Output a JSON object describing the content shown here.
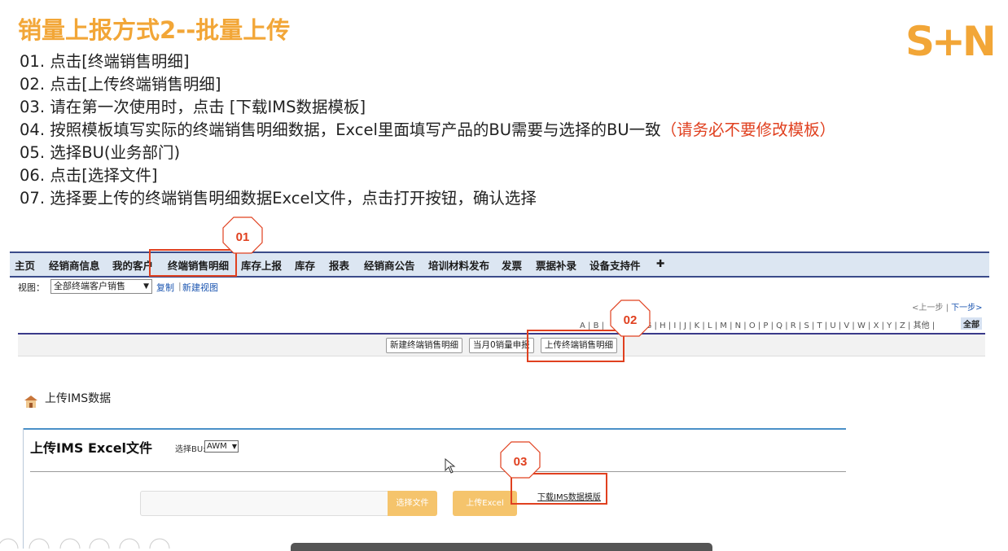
{
  "title": "销量上报方式2--批量上传",
  "logo": "S+N",
  "steps": [
    "01. 点击[终端销售明细]",
    "02. 点击[上传终端销售明细]",
    "03. 请在第一次使用时，点击 [下载IMS数据模板]",
    "04. 按照模板填写实际的终端销售明细数据，Excel里面填写产品的BU需要与选择的BU一致",
    "05. 选择BU(业务部门)",
    "06. 点击[选择文件]",
    "07. 选择要上传的终端销售明细数据Excel文件，点击打开按钮，确认选择"
  ],
  "step4_warning": "（请务必不要修改模板）",
  "callouts": [
    "01",
    "02",
    "03"
  ],
  "nav": {
    "items": [
      "主页",
      "经销商信息",
      "我的客户",
      "终端销售明细",
      "库存上报",
      "库存",
      "报表",
      "经销商公告",
      "培训材料发布",
      "发票",
      "票据补录",
      "设备支持件",
      "✚"
    ]
  },
  "view": {
    "label": "视图：",
    "selected": "全部终端客户销售",
    "copy": "复制",
    "separator": "|",
    "new_view": "新建视图"
  },
  "pager": {
    "prev": "<上一步",
    "sep": "|",
    "next": "下一步>"
  },
  "alphabet": "A | B |         | F | G | H | I | J | K | L | M | N | O | P | Q | R | S | T | U | V | W | X | Y | Z | 其他 |",
  "alphabet_all": "全部",
  "list_buttons": [
    "新建终端销售明细",
    "当月0销量申报",
    "上传终端销售明细"
  ],
  "upload": {
    "heading": "上传IMS数据",
    "panel_title": "上传IMS Excel文件",
    "bu_label": "选择BU:",
    "bu_value": "AWM",
    "choose_file": "选择文件",
    "upload_excel": "上传Excel",
    "download_template": "下载IMS数据模版"
  },
  "colors": {
    "brand": "#F2A637",
    "highlight": "#E0401F",
    "nav_bg": "#DCE6F2",
    "button_fill": "#F5C46C"
  }
}
